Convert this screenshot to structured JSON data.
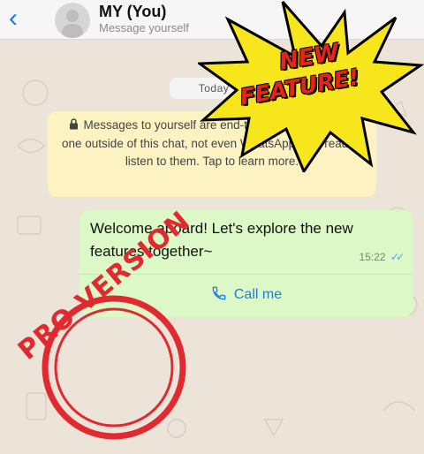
{
  "header": {
    "back_icon": "chevron-left-icon",
    "title": "MY (You)",
    "subtitle": "Message yourself"
  },
  "chat": {
    "date_label": "Today",
    "encryption_notice": "Messages to yourself are end-to-end encrypted. No one outside of this chat, not even WhatsApp, can read or listen to them. Tap to learn more.",
    "message": {
      "text": "Welcome aboard! Let's explore the new features together~",
      "time": "15:22",
      "status_icon": "double-check-icon",
      "action_label": "Call me",
      "action_icon": "phone-icon"
    }
  },
  "overlays": {
    "burst_line1": "NEW",
    "burst_line2": "FEATURE!",
    "stamp_text": "PRO VERSION"
  },
  "colors": {
    "accent": "#0a7aff",
    "bubble": "#dcf8c6",
    "notice": "#fcf2c2",
    "burst_yellow": "#f7e61c",
    "burst_blue": "#1d4fbf",
    "stamp_red": "#e02a2f"
  }
}
